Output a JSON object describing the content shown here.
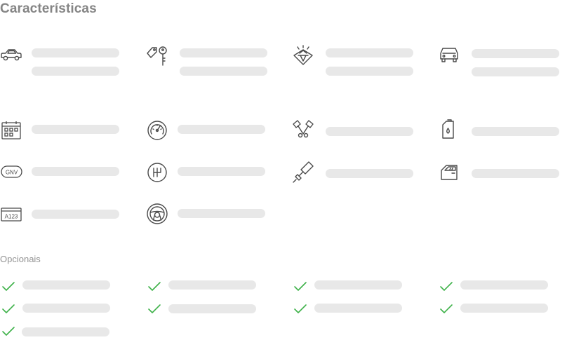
{
  "page": {
    "title": "Características",
    "optionals_title": "Opcionais"
  },
  "characteristics": [
    {
      "icon": "car-icon"
    },
    {
      "icon": "key-tag-icon"
    },
    {
      "icon": "diamond-icon"
    },
    {
      "icon": "car-front-icon"
    },
    {
      "icon": "calendar-icon"
    },
    {
      "icon": "speedometer-icon"
    },
    {
      "icon": "engine-pistons-icon"
    },
    {
      "icon": "fuel-can-icon"
    },
    {
      "icon": "gnv-badge-icon"
    },
    {
      "icon": "gear-shift-icon"
    },
    {
      "icon": "paint-roller-icon"
    },
    {
      "icon": "car-door-icon"
    },
    {
      "icon": "license-plate-icon"
    },
    {
      "icon": "steering-wheel-icon"
    }
  ],
  "optionals": [
    {
      "icon": "check-icon"
    },
    {
      "icon": "check-icon"
    },
    {
      "icon": "check-icon"
    },
    {
      "icon": "check-icon"
    },
    {
      "icon": "check-icon"
    },
    {
      "icon": "check-icon"
    },
    {
      "icon": "check-icon"
    },
    {
      "icon": "check-icon"
    },
    {
      "icon": "check-icon"
    }
  ],
  "colors": {
    "check": "#3fb24a",
    "placeholder": "#e8e8e8",
    "icon_stroke": "#4a4a4a"
  }
}
